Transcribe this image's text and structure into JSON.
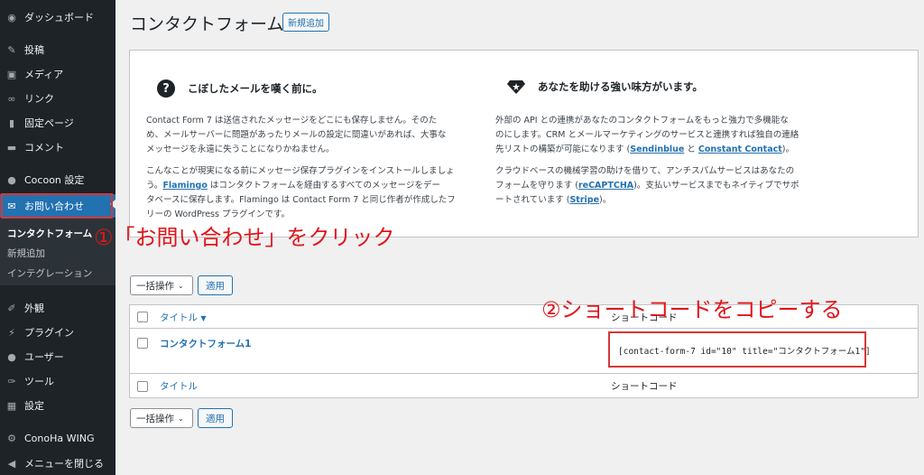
{
  "sidebar": {
    "dashboard": "ダッシュボード",
    "posts": "投稿",
    "media": "メディア",
    "links": "リンク",
    "pages": "固定ページ",
    "comments": "コメント",
    "cocoon": "Cocoon 設定",
    "contact": "お問い合わせ",
    "sub_forms": "コンタクトフォーム",
    "sub_add": "新規追加",
    "sub_integration": "インテグレーション",
    "appearance": "外観",
    "plugins": "プラグイン",
    "users": "ユーザー",
    "tools": "ツール",
    "settings": "設定",
    "conoha": "ConoHa WING",
    "collapse": "メニューを閉じる"
  },
  "header": {
    "title": "コンタクトフォーム",
    "add_new": "新規追加"
  },
  "welcome": {
    "left_title": "こぼしたメールを嘆く前に。",
    "left_p1_l1": "Contact Form 7 は送信されたメッセージをどこにも保存しません。そのた",
    "left_p1_l2": "め、メールサーバーに問題があったりメールの設定に間違いがあれば、大事な",
    "left_p1_l3": "メッセージを永遠に失うことになりかねません。",
    "left_p2_l1": "こんなことが現実になる前にメッセージ保存プラグインをインストールしましょ",
    "left_p2_l2a": "う。",
    "left_p2_l2_link": "Flamingo",
    "left_p2_l2b": " はコンタクトフォームを経由するすべてのメッセージをデー",
    "left_p2_l3": "タベースに保存します。Flamingo は Contact Form 7 と同じ作者が作成したフ",
    "left_p2_l4": "リーの WordPress プラグインです。",
    "right_title": "あなたを助ける強い味方がいます。",
    "right_p1_l1": "外部の API との連携があなたのコンタクトフォームをもっと強力で多機能な",
    "right_p1_l2": "のにします。CRM とメールマーケティングのサービスと連携すれば独自の連絡",
    "right_p1_l3a": "先リストの構築が可能になります (",
    "right_p1_link1": "Sendinblue",
    "right_p1_l3b": " と ",
    "right_p1_link2": "Constant Contact",
    "right_p1_l3c": ")。",
    "right_p2_l1": "クラウドベースの機械学習の助けを借りて、アンチスパムサービスはあなたの",
    "right_p2_l2a": "フォームを守ります (",
    "right_p2_link1": "reCAPTCHA",
    "right_p2_l2b": ")。支払いサービスまでもネイティブでサポ",
    "right_p2_l3a": "ートされています (",
    "right_p2_link2": "Stripe",
    "right_p2_l3b": ")。"
  },
  "bulk": {
    "label": "一括操作",
    "apply": "適用"
  },
  "table": {
    "col_title": "タイトル",
    "col_title_sort": "▼",
    "col_shortcode": "ショートコード",
    "rows": [
      {
        "title": "コンタクトフォーム1",
        "shortcode": "[contact-form-7 id=\"10\" title=\"コンタクトフォーム1\"]"
      }
    ]
  },
  "annotations": {
    "step1": "①「お問い合わせ」をクリック",
    "step2": "②ショートコードをコピーする"
  },
  "colors": {
    "accent": "#2271b1",
    "sidebar_bg": "#1d2327",
    "annotation_red": "#e0161b"
  }
}
